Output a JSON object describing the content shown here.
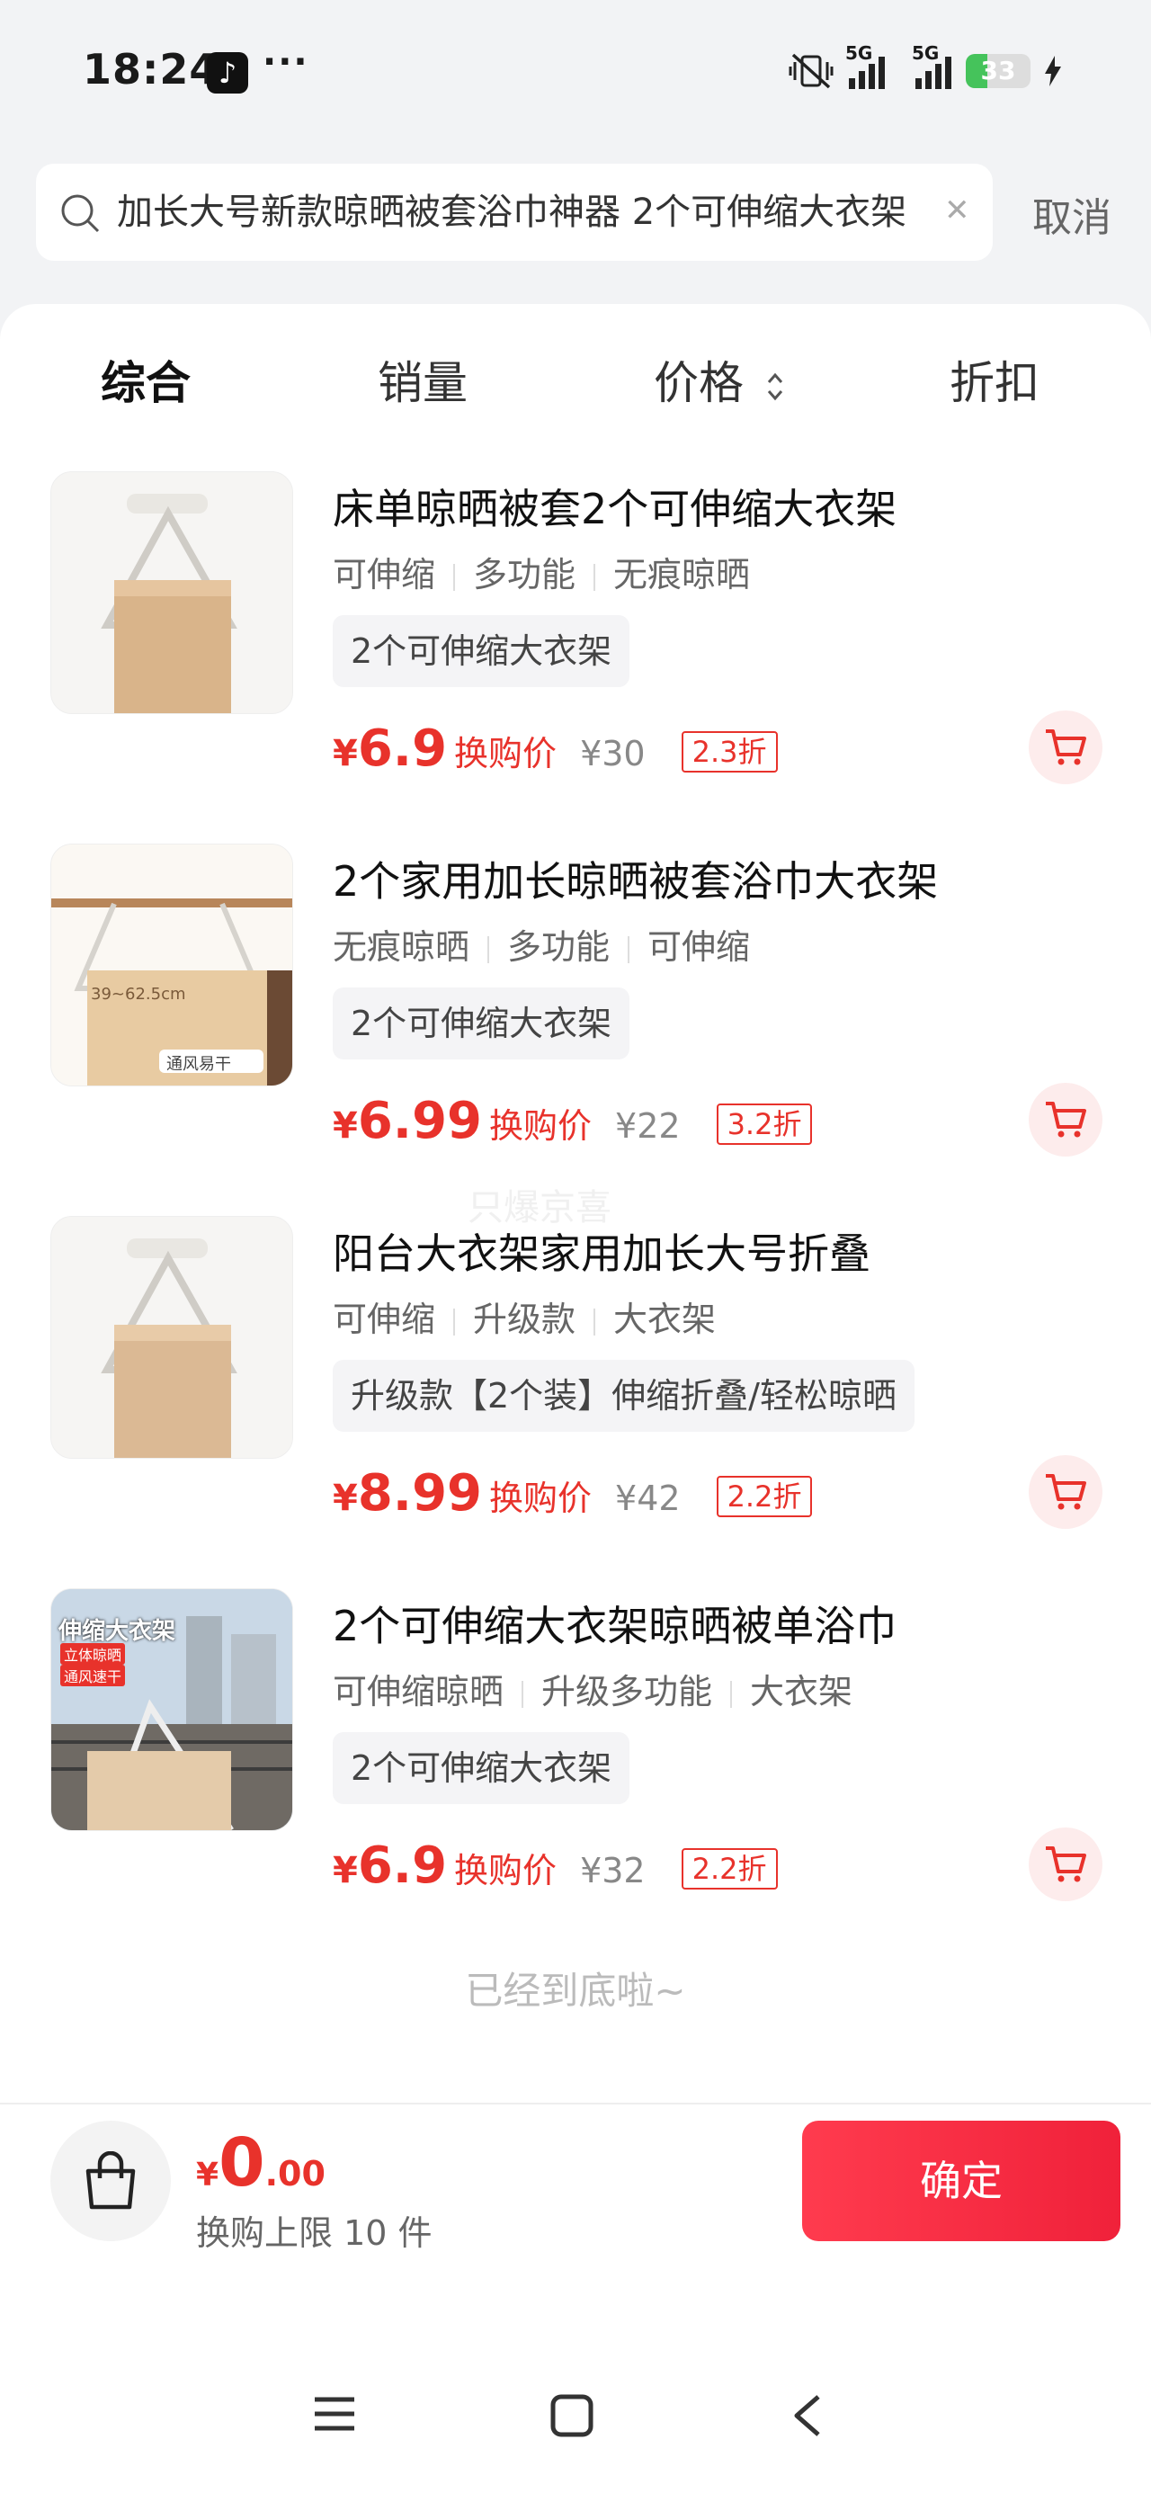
{
  "status_bar": {
    "time": "18:24",
    "net1": "5G",
    "net2": "5G",
    "battery": "33"
  },
  "search": {
    "query": "加长大号新款晾晒被套浴巾神器 2个可伸缩大衣架",
    "cancel_label": "取消"
  },
  "sort_tabs": [
    "综合",
    "销量",
    "价格",
    "折扣"
  ],
  "products": [
    {
      "title": "床单晾晒被套2个可伸缩大衣架",
      "tags": [
        "可伸缩",
        "多功能",
        "无痕晾晒"
      ],
      "variant": "2个可伸缩大衣架",
      "price_currency": "¥",
      "price": "6.9",
      "swap_label": "换购价",
      "original_price": "¥30",
      "discount": "2.3折"
    },
    {
      "title": "2个家用加长晾晒被套浴巾大衣架",
      "tags": [
        "无痕晾晒",
        "多功能",
        "可伸缩"
      ],
      "variant": "2个可伸缩大衣架",
      "price_currency": "¥",
      "price": "6.99",
      "swap_label": "换购价",
      "original_price": "¥22",
      "discount": "3.2折",
      "image_caption": "通风易干",
      "image_measure": "39~62.5cm"
    },
    {
      "title": "阳台大衣架家用加长大号折叠",
      "tags": [
        "可伸缩",
        "升级款",
        "大衣架"
      ],
      "variant": "升级款【2个装】伸缩折叠/轻松晾晒",
      "price_currency": "¥",
      "price": "8.99",
      "swap_label": "换购价",
      "original_price": "¥42",
      "discount": "2.2折"
    },
    {
      "title": "2个可伸缩大衣架晾晒被单浴巾",
      "tags": [
        "可伸缩晾晒",
        "升级多功能",
        "大衣架"
      ],
      "variant": "2个可伸缩大衣架",
      "price_currency": "¥",
      "price": "6.9",
      "swap_label": "换购价",
      "original_price": "¥32",
      "discount": "2.2折",
      "image_caption": "伸缩大衣架",
      "image_badge1": "立体晾晒",
      "image_badge2": "通风速干"
    }
  ],
  "watermark": "只爆京喜",
  "end_text": "已经到底啦~",
  "bottom": {
    "currency": "¥",
    "total_int": "0",
    "total_dec": ".00",
    "limit_text": "换购上限 10 件",
    "confirm_label": "确定"
  },
  "colors": {
    "accent": "#e8322b",
    "confirm": "#f0213a",
    "battery": "#45c35b"
  }
}
